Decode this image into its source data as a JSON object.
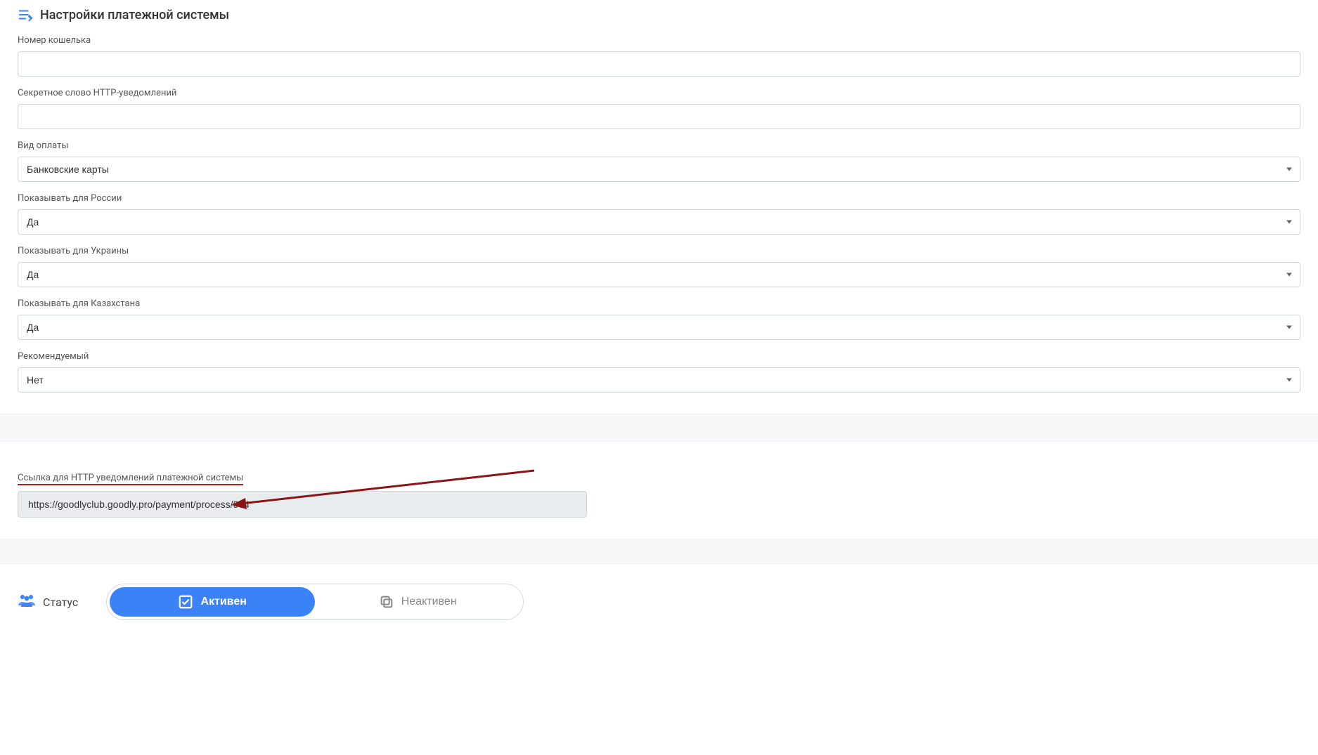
{
  "header": {
    "title": "Настройки платежной системы"
  },
  "fields": {
    "wallet": {
      "label": "Номер кошелька",
      "value": ""
    },
    "secret": {
      "label": "Секретное слово HTTP-уведомлений",
      "value": ""
    },
    "payment_type": {
      "label": "Вид оплаты",
      "value": "Банковские карты"
    },
    "show_russia": {
      "label": "Показывать для России",
      "value": "Да"
    },
    "show_ukraine": {
      "label": "Показывать для Украины",
      "value": "Да"
    },
    "show_kazakhstan": {
      "label": "Показывать для Казахстана",
      "value": "Да"
    },
    "recommended": {
      "label": "Рекомендуемый",
      "value": "Нет"
    }
  },
  "notify": {
    "label": "Ссылка для HTTP уведомлений платежной системы",
    "url": "https://goodlyclub.goodly.pro/payment/process/964"
  },
  "status": {
    "label": "Статус",
    "active_label": "Активен",
    "inactive_label": "Неактивен"
  }
}
